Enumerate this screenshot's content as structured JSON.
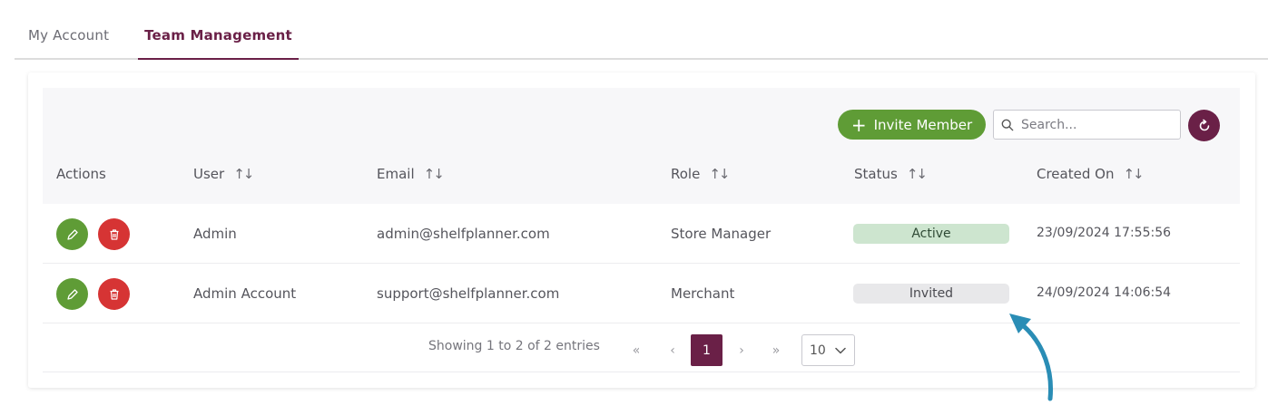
{
  "tabs": [
    {
      "label": "My Account",
      "active": false
    },
    {
      "label": "Team Management",
      "active": true
    }
  ],
  "toolbar": {
    "invite_label": "Invite Member",
    "search_placeholder": "Search...",
    "refresh_icon": "refresh-icon"
  },
  "table": {
    "columns": [
      "Actions",
      "User",
      "Email",
      "Role",
      "Status",
      "Created On"
    ],
    "sortable_icon": "↑↓",
    "rows": [
      {
        "user": "Admin",
        "email": "admin@shelfplanner.com",
        "role": "Store Manager",
        "status": "Active",
        "created_on": "23/09/2024 17:55:56"
      },
      {
        "user": "Admin Account",
        "email": "support@shelfplanner.com",
        "role": "Merchant",
        "status": "Invited",
        "created_on": "24/09/2024 14:06:54"
      }
    ]
  },
  "pagination": {
    "summary": "Showing 1 to 2 of 2 entries",
    "first": "«",
    "prev": "‹",
    "current_page": "1",
    "next": "›",
    "last": "»",
    "page_size": "10"
  },
  "colors": {
    "brand": "#6a2047",
    "green": "#5f9c36",
    "red": "#d63434",
    "annotation_arrow": "#2a8db5"
  }
}
